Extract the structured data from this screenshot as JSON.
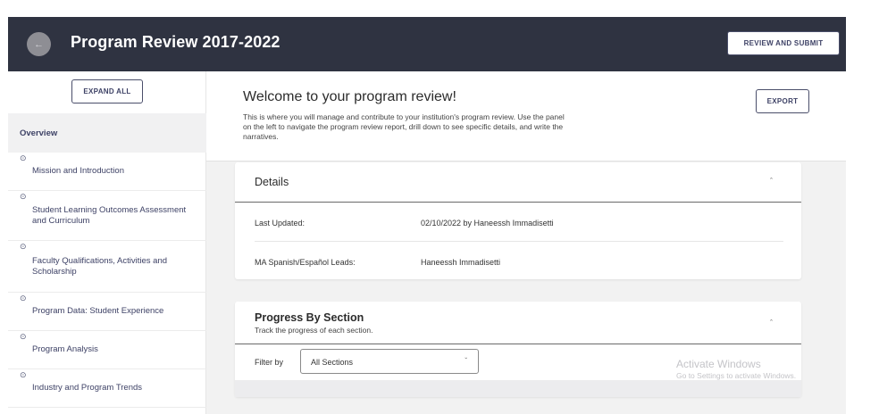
{
  "header": {
    "title": "Program Review 2017-2022",
    "back_icon": "arrow-left-icon",
    "review_submit_label": "REVIEW AND SUBMIT"
  },
  "sidebar": {
    "expand_all_label": "EXPAND ALL",
    "overview_label": "Overview",
    "items": [
      {
        "label": "Mission and Introduction"
      },
      {
        "label": "Student Learning Outcomes Assessment and Curriculum"
      },
      {
        "label": "Faculty Qualifications, Activities and Scholarship"
      },
      {
        "label": "Program Data: Student Experience"
      },
      {
        "label": "Program Analysis"
      },
      {
        "label": "Industry and Program Trends"
      }
    ]
  },
  "welcome": {
    "title": "Welcome to your program review!",
    "description": "This is where you will manage and contribute to your institution's program review. Use the panel on the left to navigate the program review report, drill down to see specific details, and write the narratives.",
    "export_label": "EXPORT"
  },
  "details": {
    "title": "Details",
    "rows": [
      {
        "label": "Last Updated:",
        "value": "02/10/2022 by Haneessh Immadisetti"
      },
      {
        "label": "MA Spanish/Español Leads:",
        "value": "Haneessh Immadisetti"
      }
    ]
  },
  "progress": {
    "title": "Progress By Section",
    "subtitle": "Track the progress of each section.",
    "filter_label": "Filter by",
    "filter_value": "All Sections"
  },
  "watermark": {
    "title": "Activate Windows",
    "subtitle": "Go to Settings to activate Windows."
  },
  "colors": {
    "header_bg": "#2f3341",
    "accent": "#3e4266",
    "page_bg": "#f2f2f2"
  }
}
